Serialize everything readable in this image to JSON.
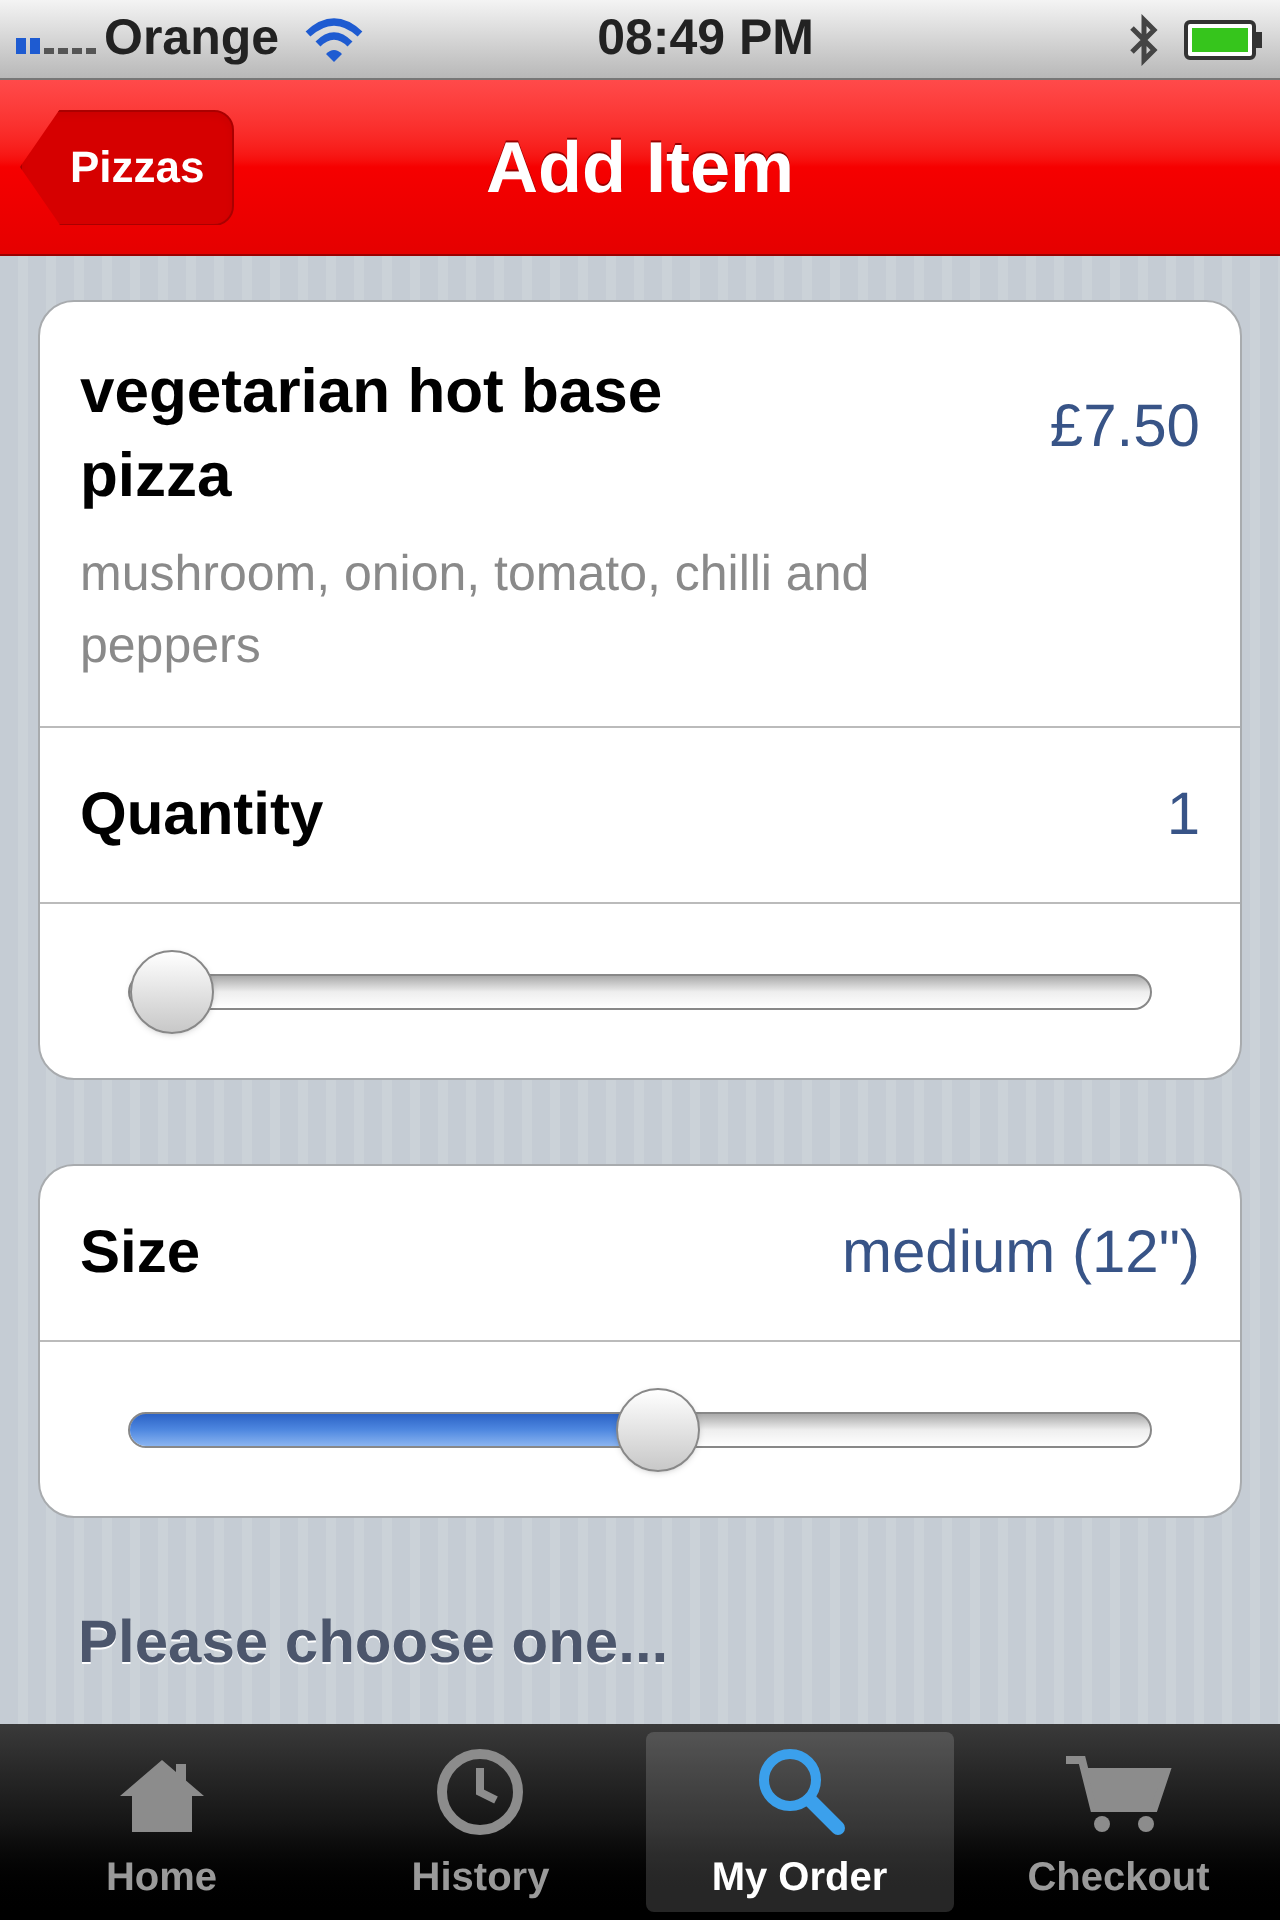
{
  "status_bar": {
    "carrier": "Orange",
    "time": "08:49 PM"
  },
  "nav_bar": {
    "back": "Pizzas",
    "title": "Add Item"
  },
  "item": {
    "name": "vegetarian hot base pizza",
    "price": "£7.50",
    "description": "mushroom, onion, tomato, chilli and peppers"
  },
  "quantity": {
    "label": "Quantity",
    "value": "1",
    "level": 0
  },
  "size": {
    "label": "Size",
    "value": "medium (12\")",
    "level": 0.52
  },
  "section_header": "Please choose one...",
  "tabs": [
    {
      "label": "Home",
      "kind": "home",
      "selected": false
    },
    {
      "label": "History",
      "kind": "clock",
      "selected": false
    },
    {
      "label": "My Order",
      "kind": "search",
      "selected": true
    },
    {
      "label": "Checkout",
      "kind": "cart",
      "selected": false
    }
  ]
}
